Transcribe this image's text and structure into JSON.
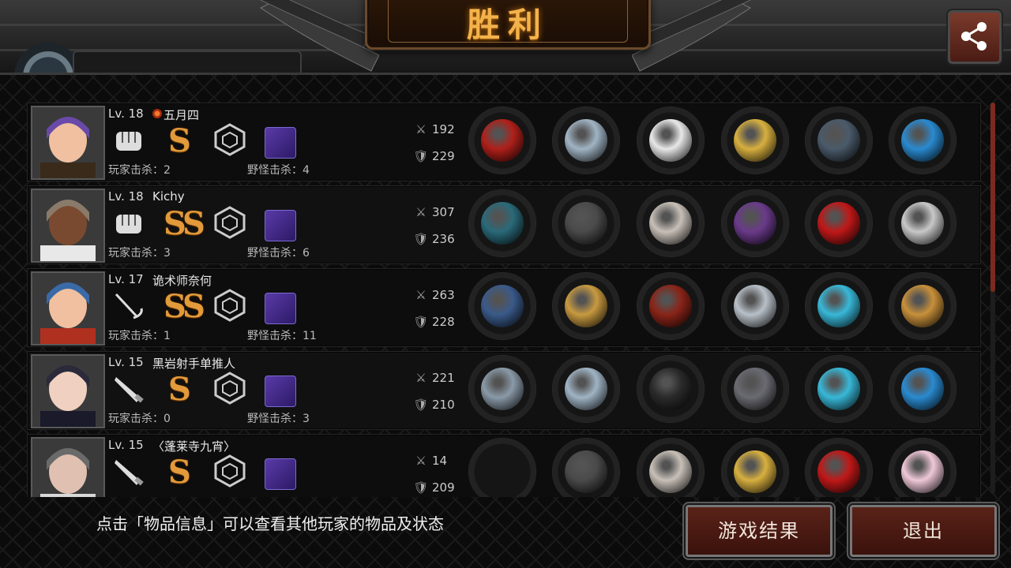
{
  "header": {
    "title": "胜利",
    "share_icon": "share-icon"
  },
  "players": [
    {
      "level": "Lv. 18",
      "name": "五月四",
      "has_guild_icon": true,
      "class_icon": "fist-icon",
      "grade": "S",
      "kills": "玩家击杀：2",
      "mob_kills": "野怪击杀：4",
      "attack": "192",
      "defense": "229",
      "items": [
        "crimson-revolver",
        "silver-helmet",
        "white-coat",
        "golden-bracelet",
        "dark-boots",
        "blue-gem-ring"
      ]
    },
    {
      "level": "Lv. 18",
      "name": "Kichy",
      "has_guild_icon": false,
      "class_icon": "fist-icon",
      "grade": "SS",
      "kills": "玩家击杀：3",
      "mob_kills": "野怪击杀：6",
      "attack": "307",
      "defense": "236",
      "items": [
        "dark-gauntlet-claw",
        "knight-helmet",
        "silver-armor",
        "purple-gauntlet",
        "red-heels",
        "silver-pearl"
      ]
    },
    {
      "level": "Lv. 17",
      "name": "诡术师奈何",
      "has_guild_icon": false,
      "class_icon": "sword-icon",
      "grade": "SS",
      "kills": "玩家击杀：1",
      "mob_kills": "野怪击杀：11",
      "attack": "263",
      "defense": "228",
      "items": [
        "trident-spear",
        "golden-helmet",
        "red-cloak",
        "silver-gauntlet",
        "cyan-sneakers",
        "mystery-box"
      ]
    },
    {
      "level": "Lv. 15",
      "name": "黑岩射手单推人",
      "has_guild_icon": false,
      "class_icon": "knife-icon",
      "grade": "S",
      "kills": "玩家击杀：0",
      "mob_kills": "野怪击杀：3",
      "attack": "221",
      "defense": "210",
      "items": [
        "combat-knife",
        "silver-helmet",
        "black-suit",
        "spiked-gauntlet",
        "cyan-sneakers",
        "blue-gem-ring"
      ]
    },
    {
      "level": "Lv. 15",
      "name": "〈蓬莱寺九宵〉",
      "has_guild_icon": false,
      "class_icon": "knife-icon",
      "grade": "S",
      "kills": "",
      "mob_kills": "",
      "attack": "14",
      "defense": "209",
      "items": [
        "empty",
        "knight-helmet",
        "silver-armor",
        "golden-bracelet",
        "red-heels",
        "pink-pearl"
      ]
    }
  ],
  "footer": {
    "hint": "点击「物品信息」可以查看其他玩家的物品及状态",
    "result_button": "游戏结果",
    "exit_button": "退出"
  },
  "colors": {
    "title": "#f4b24a",
    "grade": "#e29a3a",
    "button_bg": "#5a2218"
  }
}
